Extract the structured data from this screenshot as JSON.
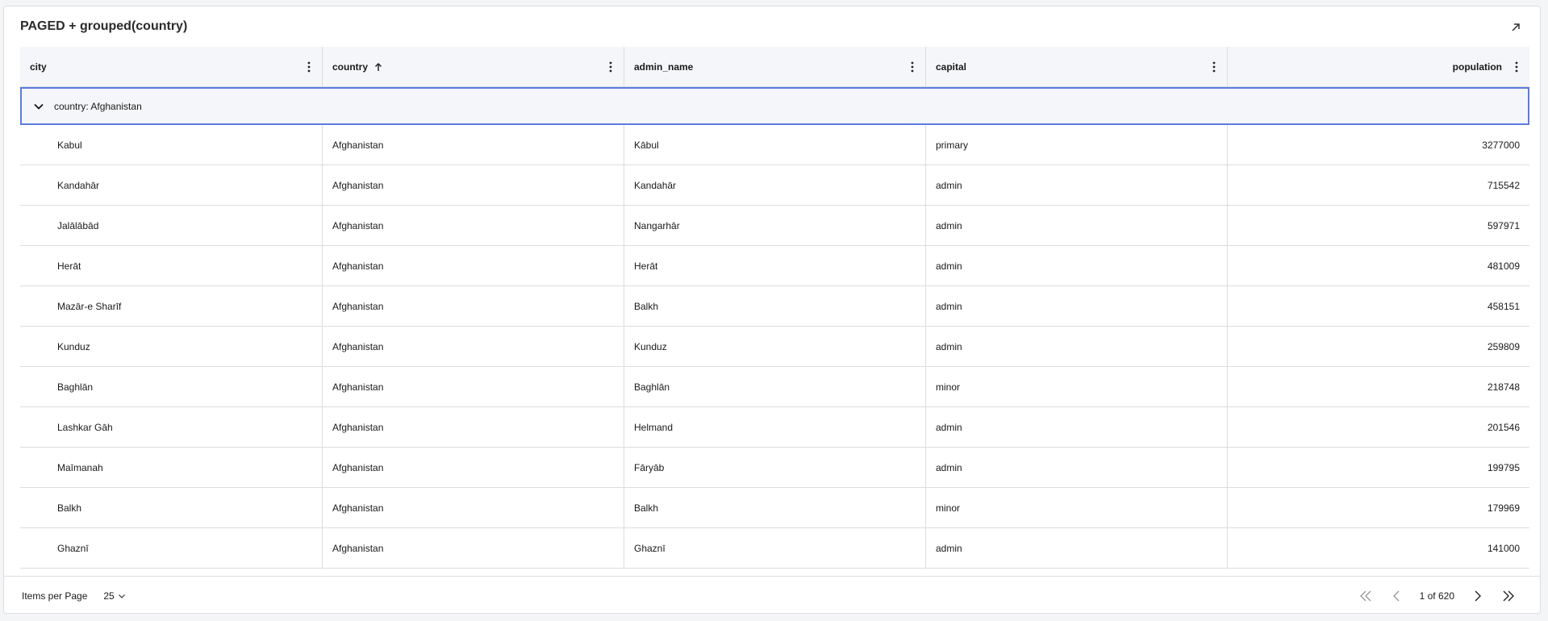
{
  "card": {
    "title": "PAGED + grouped(country)"
  },
  "columns": [
    {
      "key": "city",
      "label": "city",
      "sorted": false
    },
    {
      "key": "country",
      "label": "country",
      "sorted": true,
      "sort_dir": "ascending"
    },
    {
      "key": "admin_name",
      "label": "admin_name",
      "sorted": false
    },
    {
      "key": "capital",
      "label": "capital",
      "sorted": false
    },
    {
      "key": "population",
      "label": "population",
      "sorted": false
    }
  ],
  "group": {
    "label": "country: Afghanistan",
    "expanded": true
  },
  "rows": [
    [
      "Kabul",
      "Afghanistan",
      "Kābul",
      "primary",
      "3277000"
    ],
    [
      "Kandahār",
      "Afghanistan",
      "Kandahār",
      "admin",
      "715542"
    ],
    [
      "Jalālābād",
      "Afghanistan",
      "Nangarhār",
      "admin",
      "597971"
    ],
    [
      "Herāt",
      "Afghanistan",
      "Herāt",
      "admin",
      "481009"
    ],
    [
      "Mazār-e Sharīf",
      "Afghanistan",
      "Balkh",
      "admin",
      "458151"
    ],
    [
      "Kunduz",
      "Afghanistan",
      "Kunduz",
      "admin",
      "259809"
    ],
    [
      "Baghlān",
      "Afghanistan",
      "Baghlān",
      "minor",
      "218748"
    ],
    [
      "Lashkar Gāh",
      "Afghanistan",
      "Helmand",
      "admin",
      "201546"
    ],
    [
      "Maīmanah",
      "Afghanistan",
      "Fāryāb",
      "admin",
      "199795"
    ],
    [
      "Balkh",
      "Afghanistan",
      "Balkh",
      "minor",
      "179969"
    ],
    [
      "Ghaznī",
      "Afghanistan",
      "Ghaznī",
      "admin",
      "141000"
    ]
  ],
  "footer": {
    "items_per_page_label": "Items per Page",
    "items_per_page_value": "25",
    "page_info": "1 of 620"
  },
  "colors": {
    "group_border": "#5b7be0",
    "header_bg": "#f5f6f9",
    "grid_line": "#dcdde1"
  },
  "icons": {
    "expand": "arrow-up-right-icon",
    "column_menu": "vertical-dots-icon",
    "sort": "arrow-up-icon",
    "group_toggle": "chevron-down-icon",
    "first_page": "double-chevron-left-icon",
    "prev_page": "chevron-left-icon",
    "next_page": "chevron-right-icon",
    "last_page": "double-chevron-right-icon"
  }
}
